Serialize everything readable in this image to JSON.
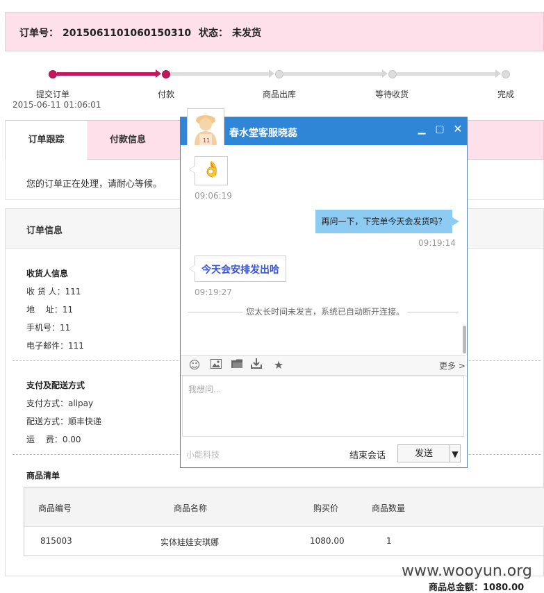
{
  "order": {
    "label": "订单号：",
    "number": "2015061101060150310",
    "status_label": "状态：",
    "status": "未发货"
  },
  "progress": {
    "steps": [
      "提交订单",
      "付款",
      "商品出库",
      "等待收货",
      "完成"
    ],
    "submit_date": "2015-06-11 01:06:01"
  },
  "tabs": {
    "items": [
      "订单跟踪",
      "付款信息"
    ],
    "active": "订单跟踪",
    "message": "您的订单正在处理，请耐心等候。"
  },
  "info": {
    "title": "订单信息",
    "receiver": {
      "title": "收货人信息",
      "rows": [
        "收 货 人：111",
        "地　 址：11",
        "手机号：11",
        "电子邮件：111"
      ]
    },
    "payment": {
      "title": "支付及配送方式",
      "rows": [
        "支付方式：alipay",
        "配送方式：顺丰快递",
        "运　 费：0.00"
      ]
    },
    "goods": {
      "title": "商品清单",
      "headers": [
        "商品编号",
        "商品名称",
        "购买价",
        "商品数量"
      ],
      "rows": [
        [
          "815003",
          "实体娃娃安琪娜",
          "1080.00",
          "1"
        ]
      ]
    },
    "total": "商品总金额：1080.00"
  },
  "watermark": "www.wooyun.org",
  "chat": {
    "title": "春水堂客服晓蕊",
    "avatar_number": "11",
    "messages": [
      {
        "dir": "in",
        "content": "👌",
        "time": "09:06:19"
      },
      {
        "dir": "out",
        "content": "再问一下，下完单今天会发货吗？",
        "time": "09:19:14"
      },
      {
        "dir": "in",
        "content": "今天会安排发出哈",
        "time": "09:19:27"
      }
    ],
    "system_notice": "您太长时间未发言，系统已自动断开连接。",
    "toolbar": {
      "icons": [
        "emoji-icon",
        "image-icon",
        "folder-icon",
        "download-icon",
        "star-icon"
      ],
      "more": "更多 >"
    },
    "input_placeholder": "我想问...",
    "brand": "小能科技",
    "end_label": "结束会话",
    "send_label": "发送",
    "send_dropdown": "▼",
    "accent": "#2f86d6",
    "bubble_out_color": "#8ecbf2"
  }
}
